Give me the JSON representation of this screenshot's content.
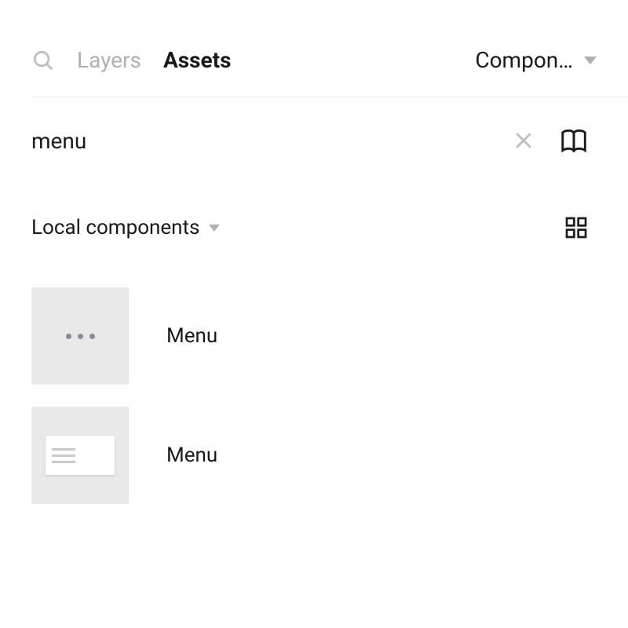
{
  "tabs": {
    "layers": "Layers",
    "assets": "Assets"
  },
  "page_selector": {
    "label": "Compon…"
  },
  "search": {
    "value": "menu"
  },
  "section": {
    "label": "Local components"
  },
  "results": [
    {
      "label": "Menu",
      "thumb_type": "dots"
    },
    {
      "label": "Menu",
      "thumb_type": "menu_preview"
    }
  ]
}
